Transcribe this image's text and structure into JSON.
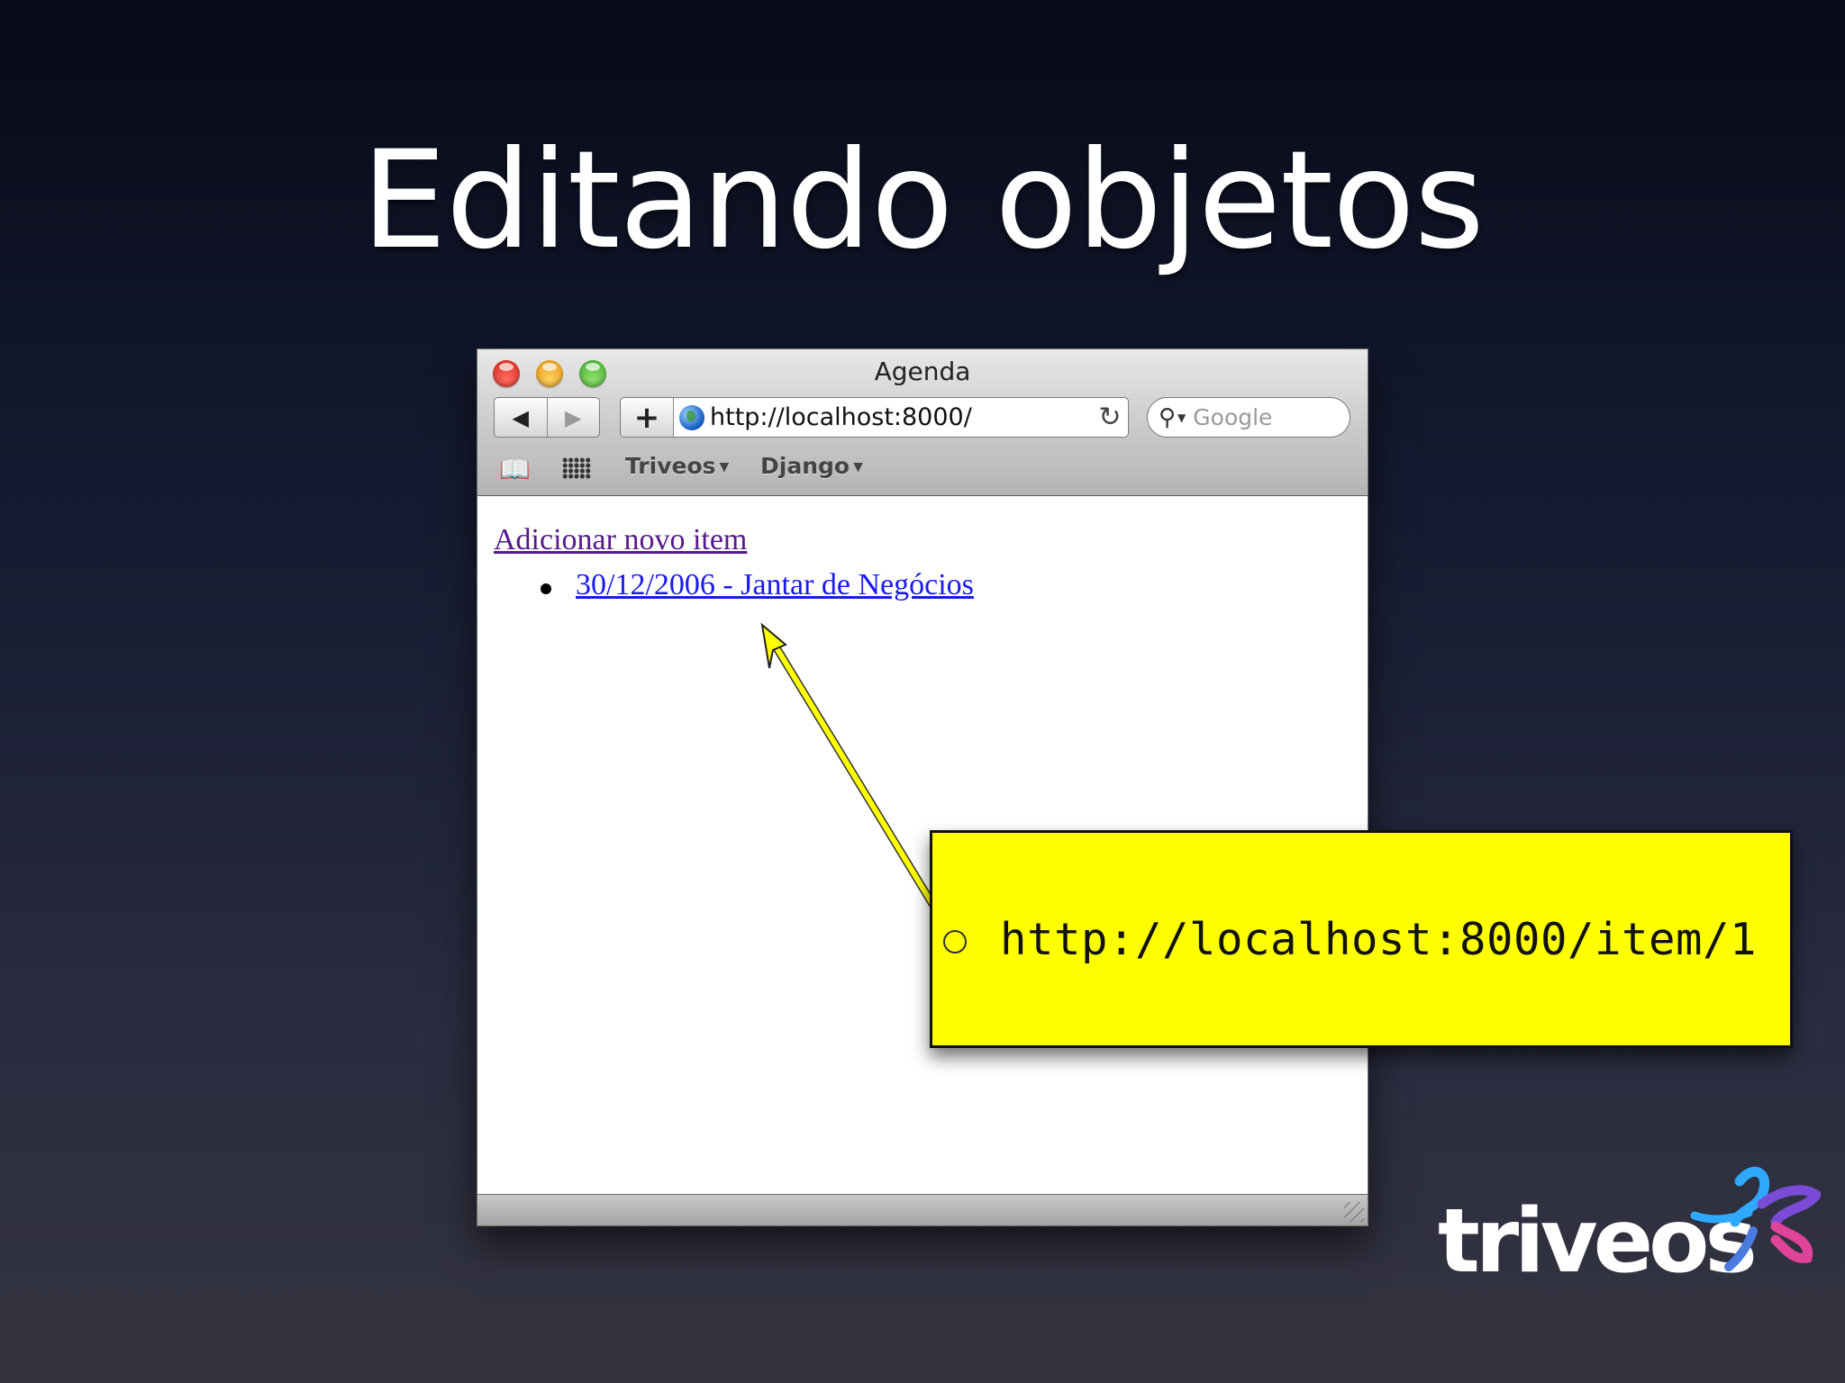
{
  "slide": {
    "title": "Editando objetos"
  },
  "browser": {
    "window_title": "Agenda",
    "url": "http://localhost:8000/",
    "search_placeholder": "Google",
    "bookmarks": [
      {
        "label": "Triveos"
      },
      {
        "label": "Django"
      }
    ]
  },
  "page": {
    "add_link": "Adicionar novo item",
    "items": [
      {
        "label": "30/12/2006 - Jantar de Negócios"
      }
    ]
  },
  "callout": {
    "text": "http://localhost:8000/item/1",
    "color": "#ffff00"
  },
  "logo": {
    "text": "triveos",
    "colors": [
      "#2ea9ff",
      "#7a4bd6",
      "#e0449a"
    ]
  },
  "icons": {
    "back": "back-arrow-icon",
    "forward": "forward-arrow-icon",
    "add": "plus-icon",
    "globe": "globe-icon",
    "reload": "reload-icon",
    "search": "search-icon",
    "bookmarks": "book-icon",
    "top_sites": "grid-icon"
  }
}
